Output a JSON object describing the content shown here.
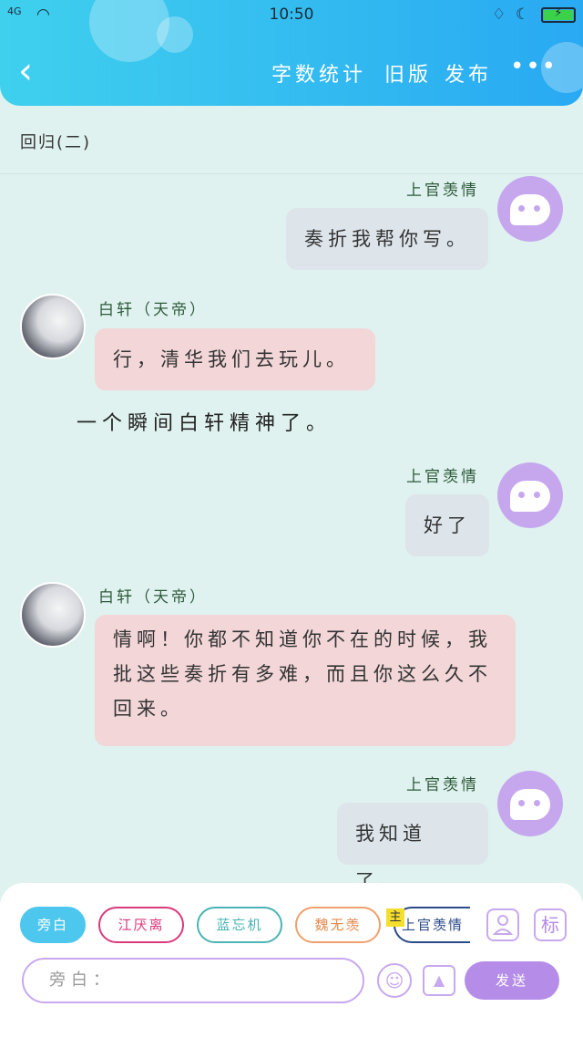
{
  "status_bar": {
    "signal": "4G",
    "time": "10:50"
  },
  "header": {
    "back": "‹",
    "nav": [
      "字数统计",
      "旧版",
      "发布"
    ],
    "more": "•••"
  },
  "chapter_title": "回归(二)",
  "messages": [
    {
      "speaker": "上官羡情",
      "side": "right",
      "text": "奏折我帮你写。"
    },
    {
      "speaker": "白轩（天帝）",
      "side": "left",
      "text": "行，清华我们去玩儿。"
    },
    {
      "speaker": "",
      "side": "narration",
      "text": "一个瞬间白轩精神了。"
    },
    {
      "speaker": "上官羡情",
      "side": "right",
      "text": "好了"
    },
    {
      "speaker": "白轩（天帝）",
      "side": "left",
      "text": "情啊！你都不知道你不在的时候，我批这些奏折有多难，而且你这么久不回来。"
    },
    {
      "speaker": "上官羡情",
      "side": "right",
      "text": "我知道了。"
    }
  ],
  "roles": [
    {
      "label": "旁白",
      "color": "#4ec7ef",
      "active": true
    },
    {
      "label": "江厌离",
      "color": "#d83a7c",
      "active": false
    },
    {
      "label": "蓝忘机",
      "color": "#4ab3b5",
      "active": false
    },
    {
      "label": "魏无羡",
      "color": "#f0a06c",
      "active": false
    },
    {
      "label": "上官羡情",
      "color": "#2b4a8a",
      "active": false,
      "badge": "主"
    }
  ],
  "toolbar": {
    "person_icon": "👤",
    "tag_label": "标"
  },
  "input": {
    "placeholder": "旁白："
  },
  "emoji_icon": "☺",
  "image_icon": "▲",
  "send_label": "发送"
}
